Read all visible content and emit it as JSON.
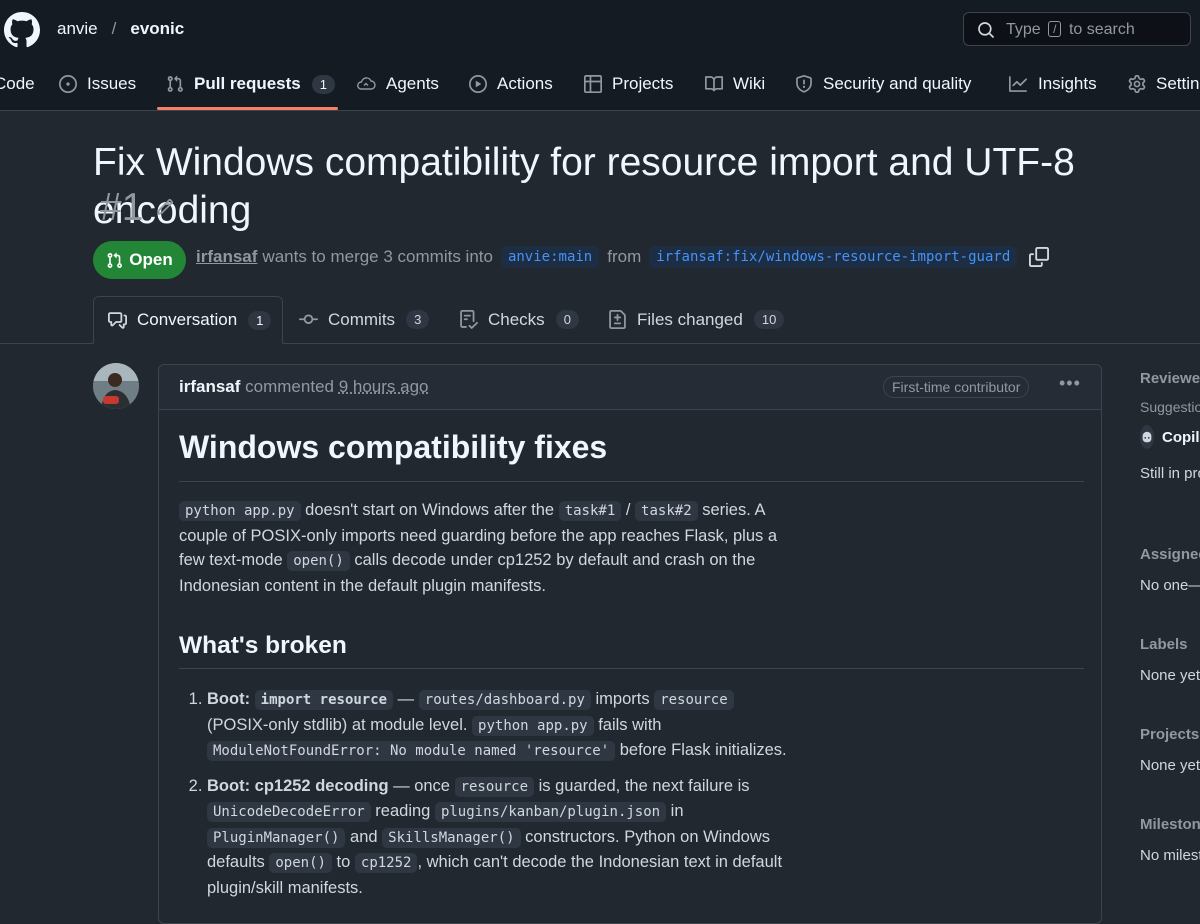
{
  "header": {
    "owner": "anvie",
    "separator": "/",
    "repo": "evonic",
    "search_prefix": "Type",
    "search_key": "/",
    "search_suffix": "to search"
  },
  "nav": {
    "tabs": [
      {
        "label": "Code"
      },
      {
        "label": "Issues"
      },
      {
        "label": "Pull requests",
        "count": "1"
      },
      {
        "label": "Agents"
      },
      {
        "label": "Actions"
      },
      {
        "label": "Projects"
      },
      {
        "label": "Wiki"
      },
      {
        "label": "Security and quality"
      },
      {
        "label": "Insights"
      },
      {
        "label": "Settings"
      }
    ],
    "active_color": "#f78166"
  },
  "pr": {
    "title": "Fix Windows compatibility for resource import and UTF-8 encoding",
    "number": "#1",
    "state": "Open",
    "state_color": "#238636",
    "author": "irfansaf",
    "merge_text": "wants to merge 3 commits into",
    "base_branch": "anvie:main",
    "from_text": "from",
    "head_branch": "irfansaf:fix/windows-resource-import-guard"
  },
  "pr_tabs": [
    {
      "label": "Conversation",
      "count": "1"
    },
    {
      "label": "Commits",
      "count": "3"
    },
    {
      "label": "Checks",
      "count": "0"
    },
    {
      "label": "Files changed",
      "count": "10"
    }
  ],
  "comment": {
    "author": "irfansaf",
    "action": "commented",
    "time": "9 hours ago",
    "badge": "First-time contributor",
    "heading": "Windows compatibility fixes",
    "intro": {
      "c1": "python app.py",
      "t1": " doesn't start on Windows after the ",
      "c2": "task#1",
      "t2": " / ",
      "c3": "task#2",
      "t3": " series. A couple of POSIX-only imports need guarding before the app reaches Flask, plus a few text-mode ",
      "c4": "open()",
      "t4": " calls decode under cp1252 by default and crash on the Indonesian content in the default plugin manifests."
    },
    "subheading": "What's broken",
    "items": [
      {
        "b1": "Boot: ",
        "bc": "import resource",
        "t1": " — ",
        "c1": "routes/dashboard.py",
        "t2": " imports ",
        "c2": "resource",
        "t3": " (POSIX-only stdlib) at module level. ",
        "c3": "python app.py",
        "t4": " fails with ",
        "c4": "ModuleNotFoundError: No module named 'resource'",
        "t5": " before Flask initializes."
      },
      {
        "b1": "Boot: cp1252 decoding",
        "t1": " — once ",
        "c1": "resource",
        "t2": " is guarded, the next failure is ",
        "c2": "UnicodeDecodeError",
        "t3": " reading ",
        "c3": "plugins/kanban/plugin.json",
        "t4": " in ",
        "c4": "PluginManager()",
        "t5": " and ",
        "c5": "SkillsManager()",
        "t6": " constructors. Python on Windows defaults ",
        "c6": "open()",
        "t7": " to ",
        "c7": "cp1252",
        "t8": ", which can't decode the Indonesian text in default plugin/skill manifests."
      }
    ]
  },
  "sidebar": {
    "reviewers": "Reviewers",
    "suggestions": "Suggestions",
    "copilot": "Copilot",
    "still": "Still in progress?",
    "assignees": "Assignees",
    "assignees_value": "No one—assign yourself",
    "labels": "Labels",
    "labels_value": "None yet",
    "projects": "Projects",
    "projects_value": "None yet",
    "milestone": "Milestone",
    "milestone_value": "No milestone"
  }
}
